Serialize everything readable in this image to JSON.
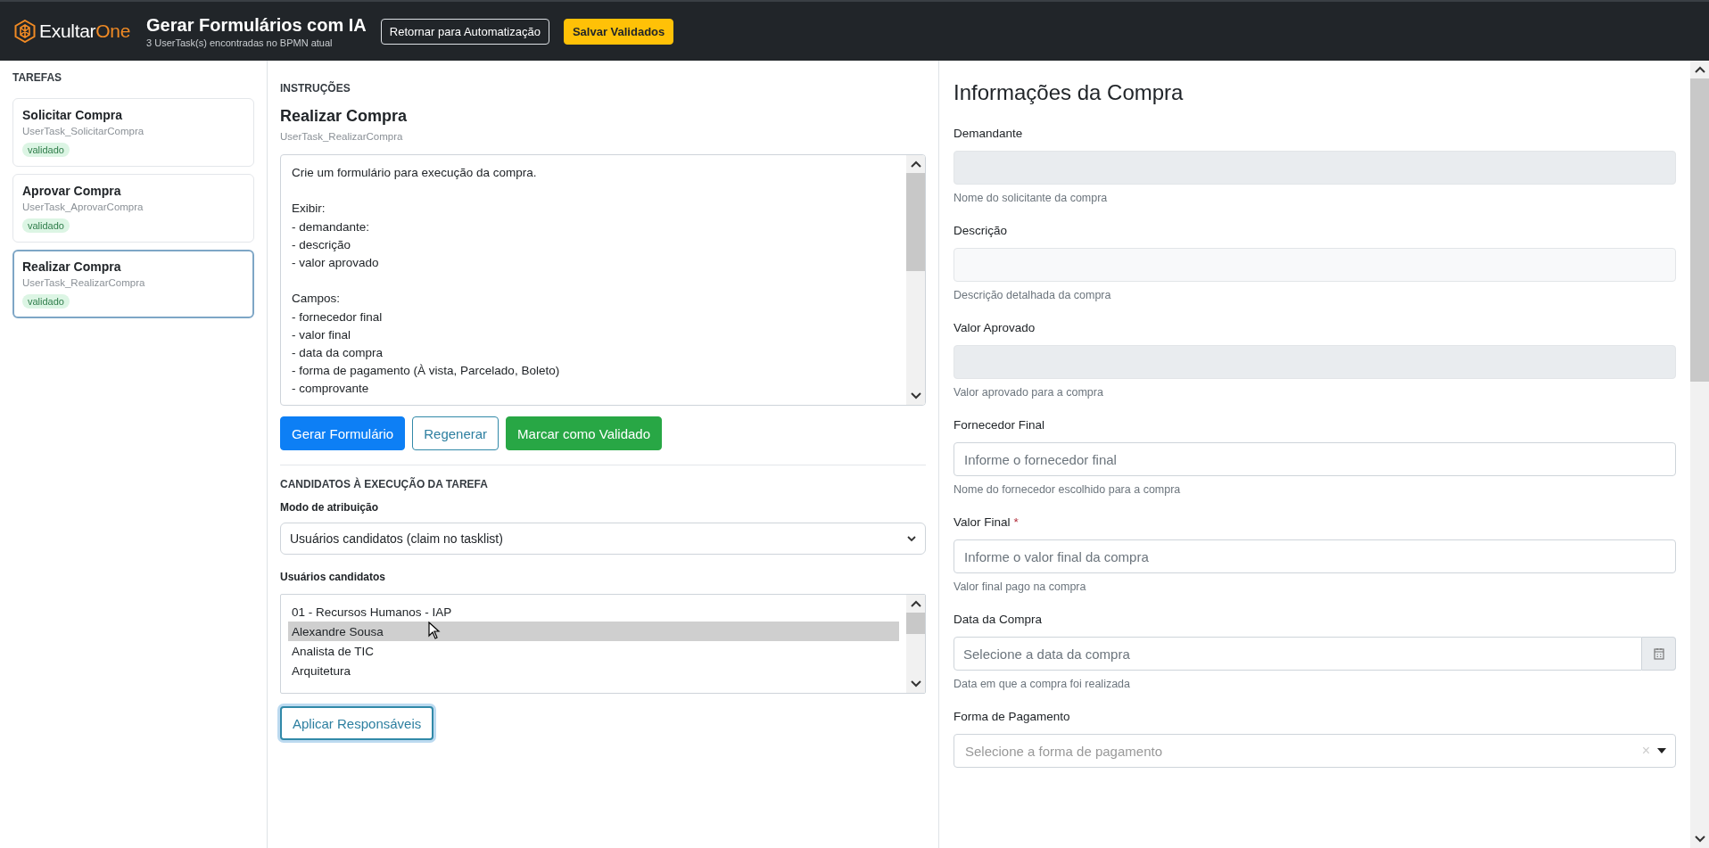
{
  "header": {
    "brand": {
      "name": "Exultar",
      "accent": "One"
    },
    "title": "Gerar Formulários com IA",
    "subtitle": "3 UserTask(s) encontradas no BPMN atual",
    "buttons": [
      {
        "label": "Retornar para Automatização",
        "kind": "outline"
      },
      {
        "label": "Salvar Validados",
        "kind": "warning"
      }
    ]
  },
  "sidebar": {
    "heading": "TAREFAS",
    "tasks": [
      {
        "name": "Solicitar Compra",
        "id": "UserTask_SolicitarCompra",
        "badge": "validado",
        "selected": false
      },
      {
        "name": "Aprovar Compra",
        "id": "UserTask_AprovarCompra",
        "badge": "validado",
        "selected": false
      },
      {
        "name": "Realizar Compra",
        "id": "UserTask_RealizarCompra",
        "badge": "validado",
        "selected": true
      }
    ]
  },
  "instructions": {
    "heading": "INSTRUÇÕES",
    "task_name": "Realizar Compra",
    "task_id": "UserTask_RealizarCompra",
    "text": "Crie um formulário para execução da compra.\n\nExibir:\n- demandante:\n- descrição\n- valor aprovado\n\nCampos:\n- fornecedor final\n- valor final\n- data da compra\n- forma de pagamento (À vista, Parcelado, Boleto)\n- comprovante",
    "buttons": [
      {
        "label": "Gerar Formulário",
        "kind": "primary"
      },
      {
        "label": "Regenerar",
        "kind": "outline"
      },
      {
        "label": "Marcar como Validado",
        "kind": "success"
      }
    ]
  },
  "candidates": {
    "heading": "CANDIDATOS À EXECUÇÃO DA TAREFA",
    "mode_label": "Modo de atribuição",
    "mode_value": "Usuários candidatos (claim no tasklist)",
    "users_label": "Usuários candidatos",
    "users": [
      {
        "label": "01 - Recursos Humanos - IAP",
        "selected": false
      },
      {
        "label": "Alexandre Sousa",
        "selected": true
      },
      {
        "label": "Analista de TIC",
        "selected": false
      },
      {
        "label": "Arquitetura",
        "selected": false
      }
    ],
    "apply_button": "Aplicar Responsáveis"
  },
  "preview": {
    "title": "Informações da Compra",
    "fields": [
      {
        "label": "Demandante",
        "kind": "disabled",
        "help": "Nome do solicitante da compra"
      },
      {
        "label": "Descrição",
        "kind": "readonly",
        "help": "Descrição detalhada da compra"
      },
      {
        "label": "Valor Aprovado",
        "kind": "disabled",
        "help": "Valor aprovado para a compra"
      },
      {
        "label": "Fornecedor Final",
        "kind": "text",
        "placeholder": "Informe o fornecedor final",
        "help": "Nome do fornecedor escolhido para a compra"
      },
      {
        "label": "Valor Final",
        "kind": "text",
        "required_mark": "*",
        "placeholder": "Informe o valor final da compra",
        "help": "Valor final pago na compra"
      },
      {
        "label": "Data da Compra",
        "kind": "date",
        "placeholder": "Selecione a data da compra",
        "help": "Data em que a compra foi realizada"
      },
      {
        "label": "Forma de Pagamento",
        "kind": "select",
        "placeholder": "Selecione a forma de pagamento",
        "clear": "×"
      }
    ]
  }
}
